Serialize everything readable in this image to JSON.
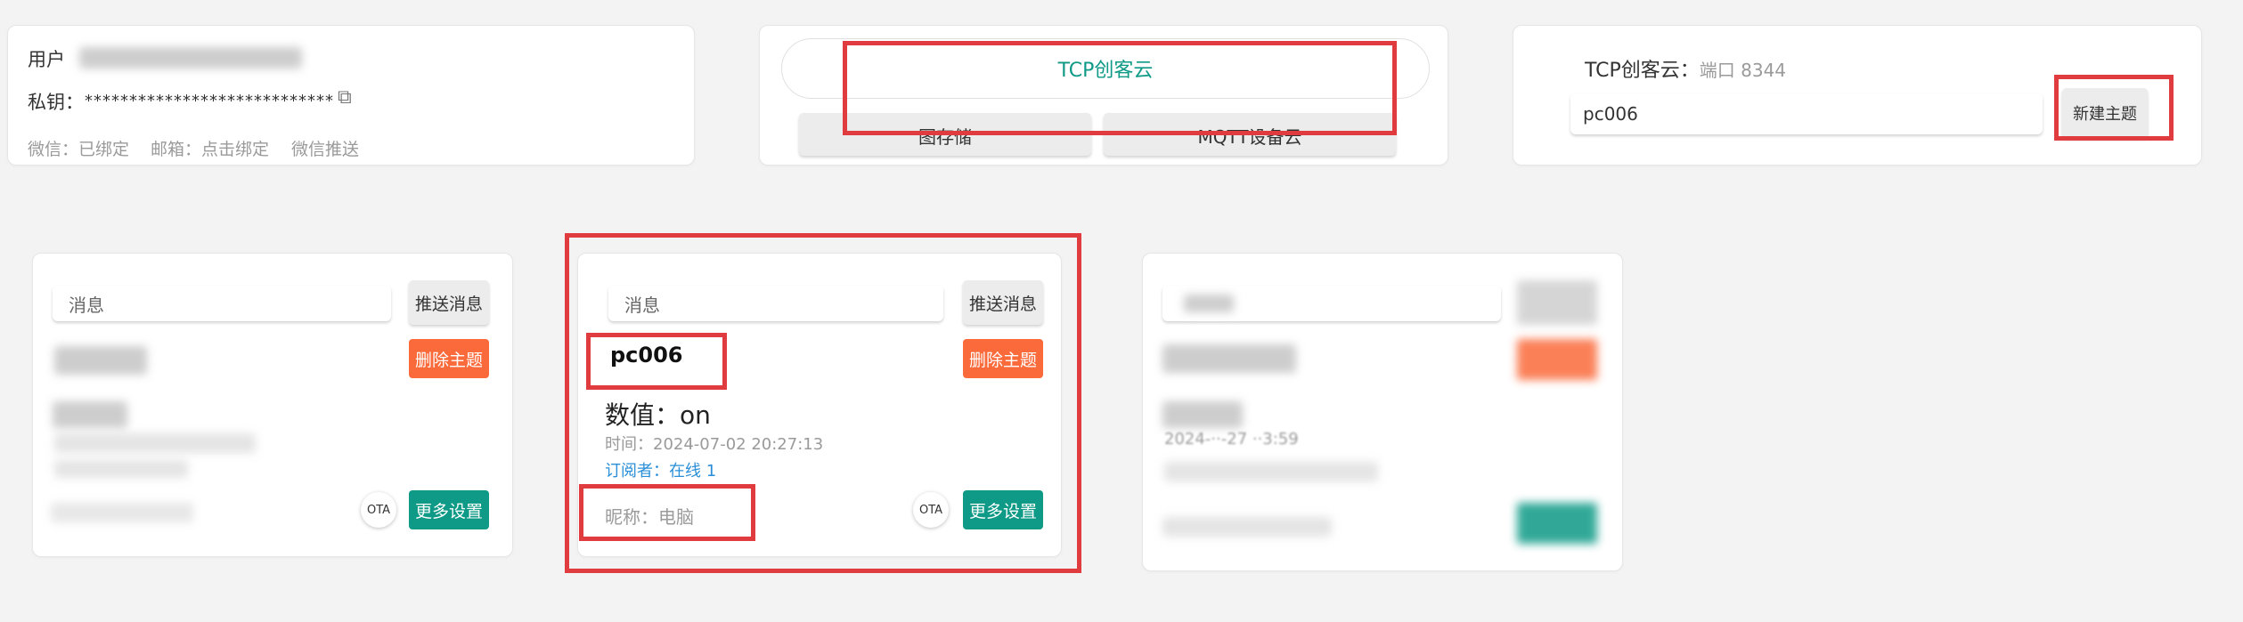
{
  "account": {
    "user_label": "用户",
    "key_label": "私钥：",
    "key_masked": "****************************",
    "wechat": "微信：已绑定",
    "email": "邮箱：点击绑定",
    "wechat_push": "微信推送"
  },
  "tabs": {
    "tcp": "TCP创客云",
    "img": "图存储",
    "mqtt": "MQTT设备云"
  },
  "tcp_panel": {
    "title": "TCP创客云：",
    "port": "端口 8344",
    "topic_input": "pc006",
    "new_topic_btn": "新建主题"
  },
  "device_card": {
    "msg_placeholder": "消息",
    "push_btn": "推送消息",
    "topic": "pc006",
    "delete_btn": "删除主题",
    "value_label": "数值：",
    "value": "on",
    "time": "时间：2024-07-02 20:27:13",
    "subscribers": "订阅者：在线 1",
    "nickname": "昵称：电脑",
    "ota": "OTA",
    "more_btn": "更多设置"
  },
  "left_card": {
    "msg_placeholder": "消息",
    "push_btn": "推送消息",
    "delete_btn": "删除主题",
    "ota": "OTA",
    "more_btn": "更多设置"
  },
  "right_card": {
    "time_partial": "2024-··-27 ··3:59"
  },
  "colors": {
    "accent": "#0e9a86",
    "danger": "#fa6a3a",
    "highlight": "#e03b3f"
  }
}
